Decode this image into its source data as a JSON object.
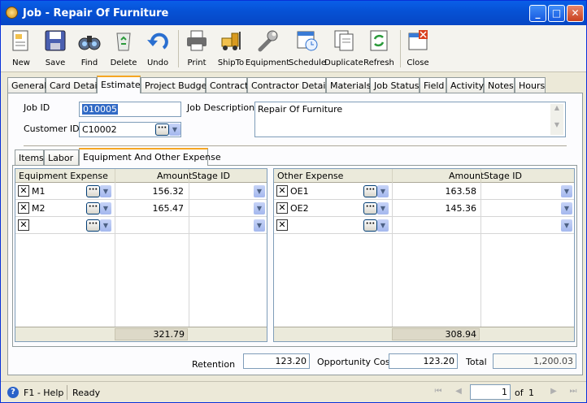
{
  "window": {
    "title": "Job - Repair Of Furniture"
  },
  "toolbar": {
    "new": "New",
    "save": "Save",
    "find": "Find",
    "delete": "Delete",
    "undo": "Undo",
    "print": "Print",
    "shipto": "ShipTo",
    "equipment": "Equipment",
    "schedule": "Schedule",
    "duplicate": "Duplicate",
    "refresh": "Refresh",
    "close": "Close"
  },
  "tabs": [
    "General",
    "Card Detail",
    "Estimate",
    "Project Budget",
    "Contract",
    "Contractor Details",
    "Materials",
    "Job Status",
    "Field",
    "Activity",
    "Notes",
    "Hours"
  ],
  "header": {
    "job_id_label": "Job ID",
    "job_id": "010005",
    "customer_id_label": "Customer ID",
    "customer_id": "C10002",
    "job_description_label": "Job Description",
    "job_description": "Repair Of Furniture"
  },
  "subtabs": [
    "Items",
    "Labor",
    "Equipment And Other Expense"
  ],
  "equipment_grid": {
    "col_expense": "Equipment Expense",
    "col_amount": "Amount",
    "col_stage": "Stage ID",
    "rows": [
      {
        "id": "M1",
        "amount": "156.32"
      },
      {
        "id": "M2",
        "amount": "165.47"
      }
    ],
    "total": "321.79"
  },
  "other_grid": {
    "col_expense": "Other Expense",
    "col_amount": "Amount",
    "col_stage": "Stage ID",
    "rows": [
      {
        "id": "OE1",
        "amount": "163.58"
      },
      {
        "id": "OE2",
        "amount": "145.36"
      }
    ],
    "total": "308.94"
  },
  "summary": {
    "retention_label": "Retention",
    "retention": "123.20",
    "opportunity_label": "Opportunity Cost",
    "opportunity": "123.20",
    "total_label": "Total",
    "total": "1,200.03"
  },
  "status": {
    "help": "F1 - Help",
    "text": "Ready",
    "page": "1",
    "of_label": "of",
    "pages": "1"
  }
}
